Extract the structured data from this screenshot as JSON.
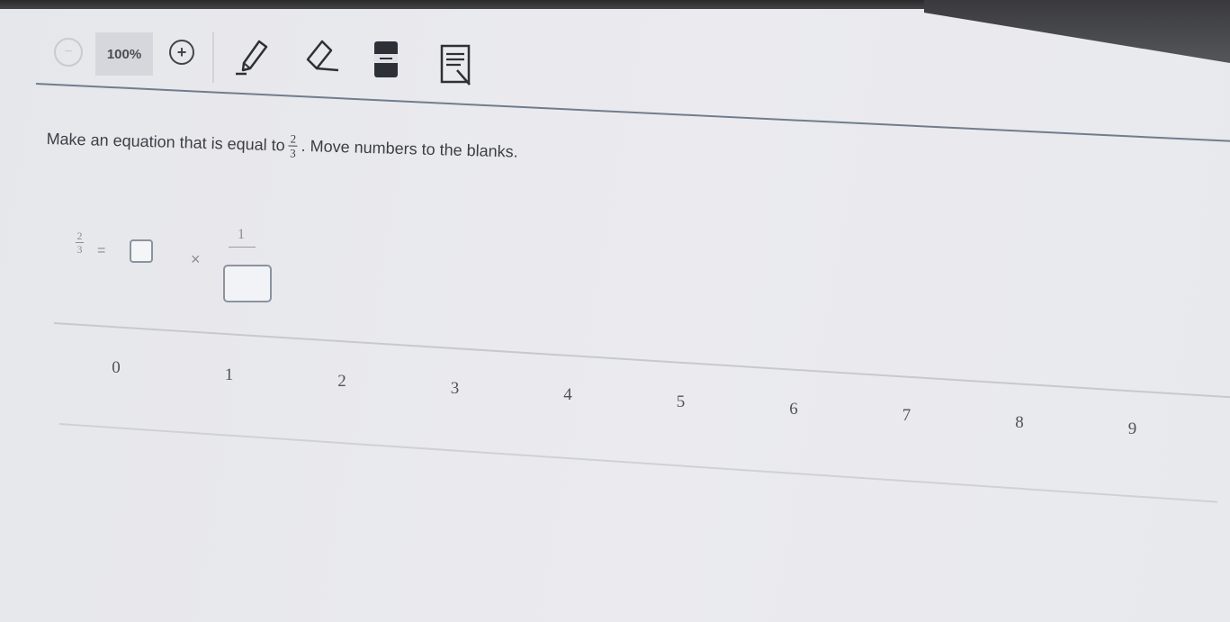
{
  "toolbar": {
    "zoom_level": "100%",
    "tools": [
      "zoom-out-icon",
      "zoom-in-icon",
      "pencil-icon",
      "eraser-icon",
      "highlighter-icon",
      "notepad-icon"
    ]
  },
  "question": {
    "instruction_before": "Make an equation that is equal to",
    "fraction_numerator": "2",
    "fraction_denominator": "3",
    "instruction_after": ". Move numbers to the blanks."
  },
  "equation": {
    "lhs_numerator": "2",
    "lhs_denominator": "3",
    "equals": "=",
    "times": "×",
    "rhs_numerator": "1"
  },
  "number_tiles": [
    "0",
    "1",
    "2",
    "3",
    "4",
    "5",
    "6",
    "7",
    "8",
    "9"
  ],
  "colors": {
    "background": "#e6e7eb",
    "text": "#3c3e46",
    "blank_border": "#8a93a0"
  }
}
